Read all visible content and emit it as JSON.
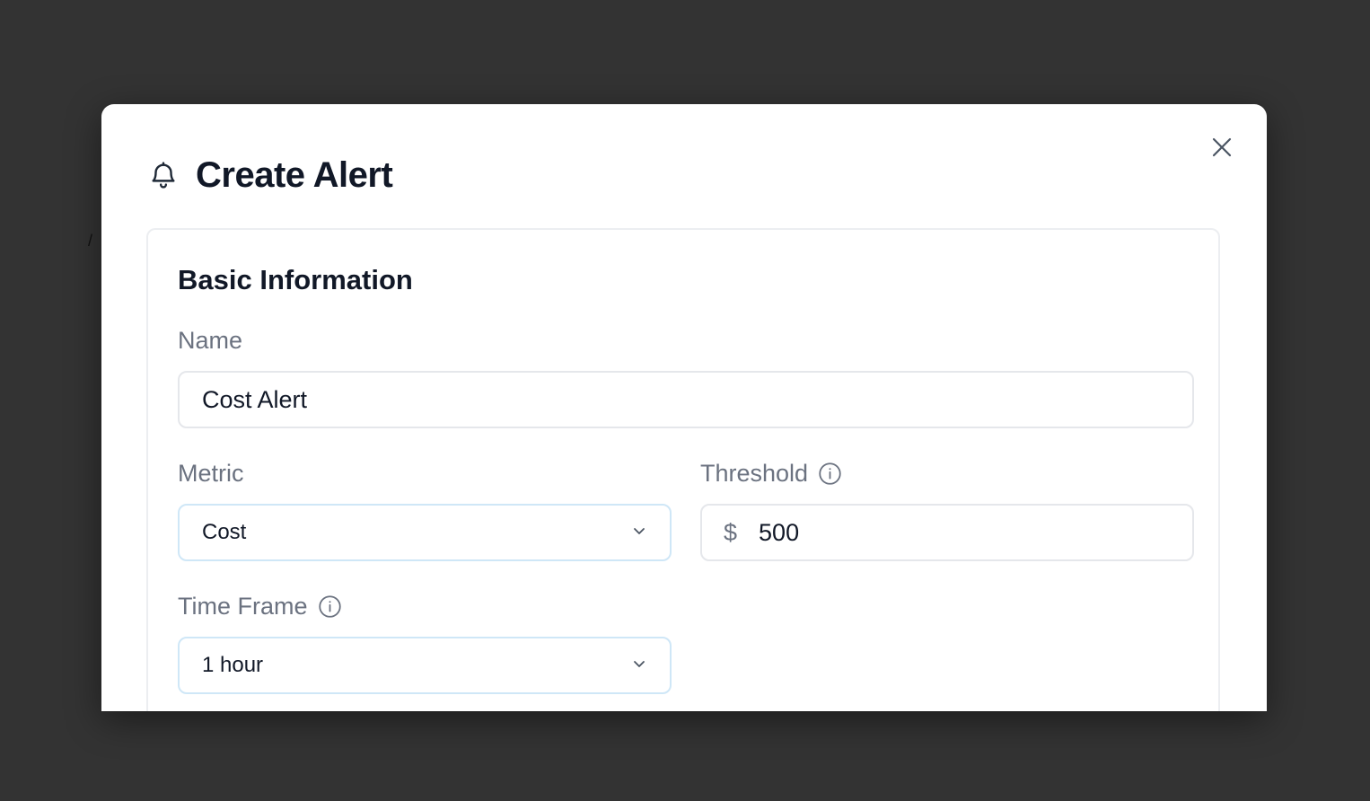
{
  "modal": {
    "title": "Create Alert",
    "title_icon": "bell-icon",
    "close_icon": "close-icon"
  },
  "basic_info": {
    "section_title": "Basic Information",
    "name": {
      "label": "Name",
      "value": "Cost Alert"
    },
    "metric": {
      "label": "Metric",
      "selected": "Cost",
      "icon": "chevron-down-icon"
    },
    "threshold": {
      "label": "Threshold",
      "currency": "$",
      "value": "500",
      "icon": "info-icon"
    },
    "time_frame": {
      "label": "Time Frame",
      "selected": "1 hour",
      "icon": "info-icon"
    }
  },
  "stray_mark": "/",
  "colors": {
    "backdrop": "#333333",
    "modal_bg": "#ffffff",
    "title": "#111827",
    "label": "#6b7280",
    "select_border": "#cfe7f7",
    "input_border": "#e5e7eb"
  }
}
